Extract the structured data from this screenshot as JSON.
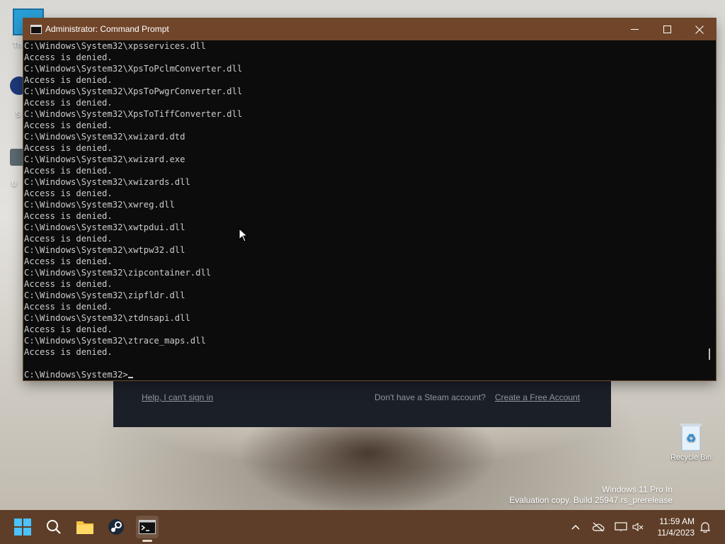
{
  "desktop": {
    "icons": [
      {
        "label": "Th"
      },
      {
        "label": "S"
      },
      {
        "label": "U"
      },
      {
        "label": "Recycle Bin"
      }
    ],
    "watermark": {
      "line1": "Windows 11 Pro In",
      "line2": "Evaluation copy. Build 25947.rs_prerelease"
    }
  },
  "steam_panel": {
    "help_link": "Help, I can't sign in",
    "no_account_text": "Don't have a Steam account?",
    "create_link": "Create a Free Account"
  },
  "window": {
    "title": "Administrator: Command Prompt",
    "minimize": "—",
    "maximize": "☐",
    "close": "✕"
  },
  "console": {
    "lines": [
      "C:\\Windows\\System32\\xpsservices.dll",
      "Access is denied.",
      "C:\\Windows\\System32\\XpsToPclmConverter.dll",
      "Access is denied.",
      "C:\\Windows\\System32\\XpsToPwgrConverter.dll",
      "Access is denied.",
      "C:\\Windows\\System32\\XpsToTiffConverter.dll",
      "Access is denied.",
      "C:\\Windows\\System32\\xwizard.dtd",
      "Access is denied.",
      "C:\\Windows\\System32\\xwizard.exe",
      "Access is denied.",
      "C:\\Windows\\System32\\xwizards.dll",
      "Access is denied.",
      "C:\\Windows\\System32\\xwreg.dll",
      "Access is denied.",
      "C:\\Windows\\System32\\xwtpdui.dll",
      "Access is denied.",
      "C:\\Windows\\System32\\xwtpw32.dll",
      "Access is denied.",
      "C:\\Windows\\System32\\zipcontainer.dll",
      "Access is denied.",
      "C:\\Windows\\System32\\zipfldr.dll",
      "Access is denied.",
      "C:\\Windows\\System32\\ztdnsapi.dll",
      "Access is denied.",
      "C:\\Windows\\System32\\ztrace_maps.dll",
      "Access is denied.",
      ""
    ],
    "prompt": "C:\\Windows\\System32>"
  },
  "taskbar": {
    "apps": [
      {
        "name": "start-icon"
      },
      {
        "name": "search-icon"
      },
      {
        "name": "file-explorer-icon"
      },
      {
        "name": "steam-icon"
      },
      {
        "name": "command-prompt-icon"
      }
    ],
    "tray": {
      "chevron": "^",
      "time": "11:59 AM",
      "date": "11/4/2023"
    }
  },
  "colors": {
    "titlebar": "#70452a",
    "taskbar": "#5e3e28",
    "console_bg": "#0c0c0c",
    "console_text": "#cccccc",
    "steam_link": "#8f98a0",
    "steam_accent": "#67c1f5"
  }
}
